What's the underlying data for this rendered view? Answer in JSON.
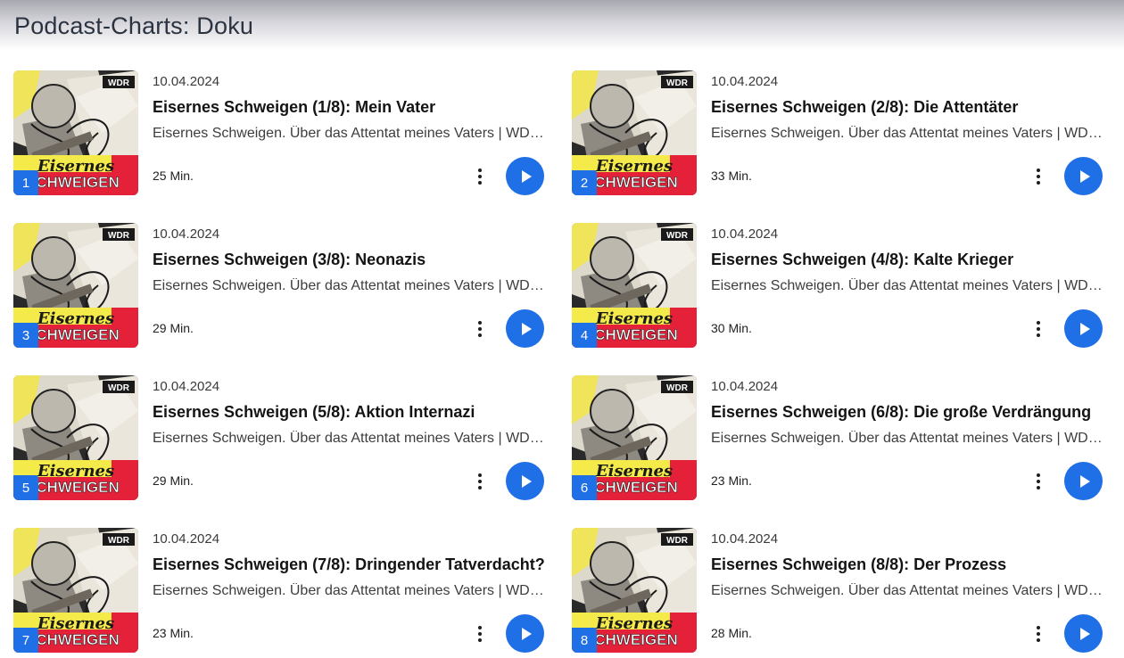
{
  "page": {
    "title": "Podcast-Charts: Doku"
  },
  "colors": {
    "accent": "#1f6fe6",
    "cover_yellow": "#f4ea4a",
    "cover_red": "#e5213a"
  },
  "episodes": [
    {
      "rank": "1",
      "date": "10.04.2024",
      "title": "Eisernes Schweigen (1/8): Mein Vater",
      "subtitle": "Eisernes Schweigen. Über das Attentat meines Vaters | WDR Doku-Podcast",
      "duration": "25 Min.",
      "cover_brand": "WDR",
      "cover_word1": "Eisernes",
      "cover_word2": "CHWEIGEN"
    },
    {
      "rank": "2",
      "date": "10.04.2024",
      "title": "Eisernes Schweigen (2/8): Die Attentäter",
      "subtitle": "Eisernes Schweigen. Über das Attentat meines Vaters | WDR Doku-Podcast",
      "duration": "33 Min.",
      "cover_brand": "WDR",
      "cover_word1": "Eisernes",
      "cover_word2": "CHWEIGEN"
    },
    {
      "rank": "3",
      "date": "10.04.2024",
      "title": "Eisernes Schweigen (3/8): Neonazis",
      "subtitle": "Eisernes Schweigen. Über das Attentat meines Vaters | WDR Doku-Podcast",
      "duration": "29 Min.",
      "cover_brand": "WDR",
      "cover_word1": "Eisernes",
      "cover_word2": "CHWEIGEN"
    },
    {
      "rank": "4",
      "date": "10.04.2024",
      "title": "Eisernes Schweigen (4/8): Kalte Krieger",
      "subtitle": "Eisernes Schweigen. Über das Attentat meines Vaters | WDR Doku-Podcast",
      "duration": "30 Min.",
      "cover_brand": "WDR",
      "cover_word1": "Eisernes",
      "cover_word2": "CHWEIGEN"
    },
    {
      "rank": "5",
      "date": "10.04.2024",
      "title": "Eisernes Schweigen (5/8): Aktion Internazi",
      "subtitle": "Eisernes Schweigen. Über das Attentat meines Vaters | WDR Doku-Podcast",
      "duration": "29 Min.",
      "cover_brand": "WDR",
      "cover_word1": "Eisernes",
      "cover_word2": "CHWEIGEN"
    },
    {
      "rank": "6",
      "date": "10.04.2024",
      "title": "Eisernes Schweigen (6/8): Die große Verdrängung",
      "subtitle": "Eisernes Schweigen. Über das Attentat meines Vaters | WDR Doku-Podcast",
      "duration": "23 Min.",
      "cover_brand": "WDR",
      "cover_word1": "Eisernes",
      "cover_word2": "CHWEIGEN"
    },
    {
      "rank": "7",
      "date": "10.04.2024",
      "title": "Eisernes Schweigen (7/8): Dringender Tatverdacht?",
      "subtitle": "Eisernes Schweigen. Über das Attentat meines Vaters | WDR Doku-Podcast",
      "duration": "23 Min.",
      "cover_brand": "WDR",
      "cover_word1": "Eisernes",
      "cover_word2": "CHWEIGEN"
    },
    {
      "rank": "8",
      "date": "10.04.2024",
      "title": "Eisernes Schweigen (8/8): Der Prozess",
      "subtitle": "Eisernes Schweigen. Über das Attentat meines Vaters | WDR Doku-Podcast",
      "duration": "28 Min.",
      "cover_brand": "WDR",
      "cover_word1": "Eisernes",
      "cover_word2": "CHWEIGEN"
    }
  ],
  "icons": {
    "more": "more-vertical-icon",
    "play": "play-icon"
  }
}
